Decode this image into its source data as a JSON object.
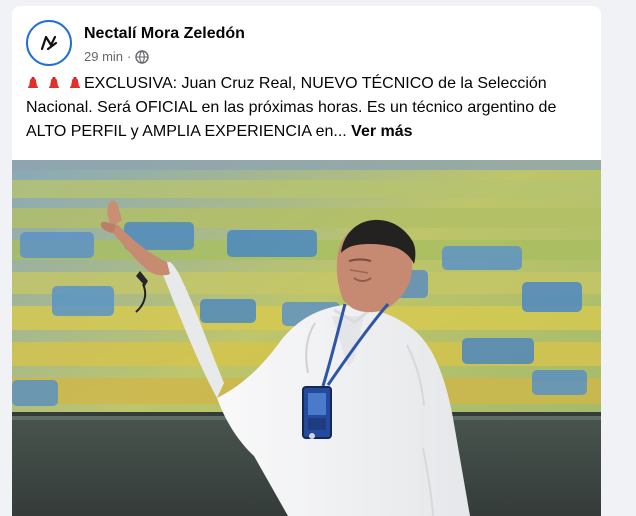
{
  "post": {
    "author_name": "Nectalí Mora Zeledón",
    "timestamp": "29 min",
    "separator": "·",
    "privacy_icon": "globe-icon",
    "content_icons": [
      "red-siren-icon",
      "red-siren-icon",
      "red-siren-icon"
    ],
    "text": "EXCLUSIVA: Juan Cruz Real, NUEVO TÉCNICO de la Selección Nacional. Será OFICIAL en las próximas horas. Es un técnico argentino de ALTO PERFIL y AMPLIA EXPERIENCIA en...",
    "see_more_label": "Ver más"
  },
  "colors": {
    "text_primary": "#050505",
    "text_secondary": "#65676b",
    "page_background": "#f0f2f5",
    "avatar_ring": "#1f6fd8",
    "siren_red": "#e0302a"
  }
}
